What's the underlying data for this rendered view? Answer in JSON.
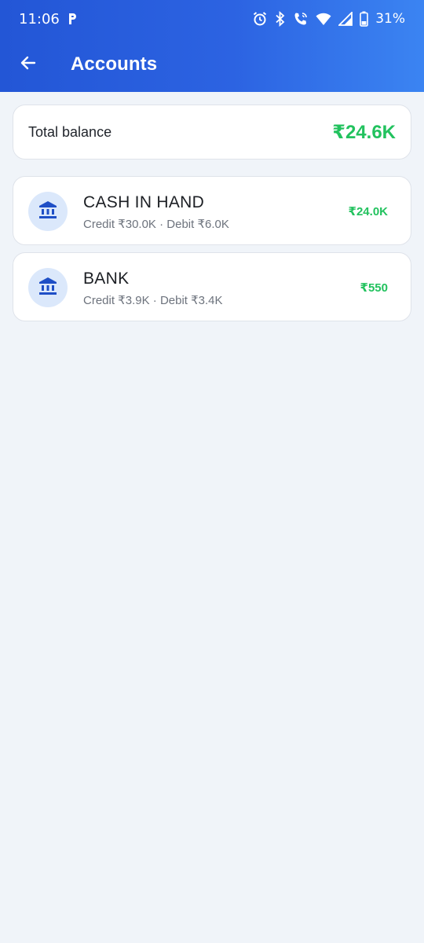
{
  "status_bar": {
    "time": "11:06",
    "battery": "31%"
  },
  "app_bar": {
    "title": "Accounts"
  },
  "summary": {
    "label": "Total balance",
    "value": "₹24.6K"
  },
  "accounts": [
    {
      "name": "CASH IN HAND",
      "credit": "Credit ₹30.0K",
      "separator": "·",
      "debit": "Debit ₹6.0K",
      "balance": "₹24.0K"
    },
    {
      "name": "BANK",
      "credit": "Credit ₹3.9K",
      "separator": "·",
      "debit": "Debit ₹3.4K",
      "balance": "₹550"
    }
  ],
  "colors": {
    "header_start": "#2356d6",
    "header_end": "#3b84f2",
    "positive": "#22c25e",
    "icon_bg": "#dbe8fb",
    "icon": "#1f4fc6",
    "background": "#f0f4f9"
  },
  "icons": {
    "back": "arrow-left-icon",
    "account": "bank-icon",
    "status": [
      "parking-icon",
      "alarm-icon",
      "bluetooth-icon",
      "wifi-call-icon",
      "wifi-icon",
      "signal-icon",
      "battery-icon"
    ]
  }
}
